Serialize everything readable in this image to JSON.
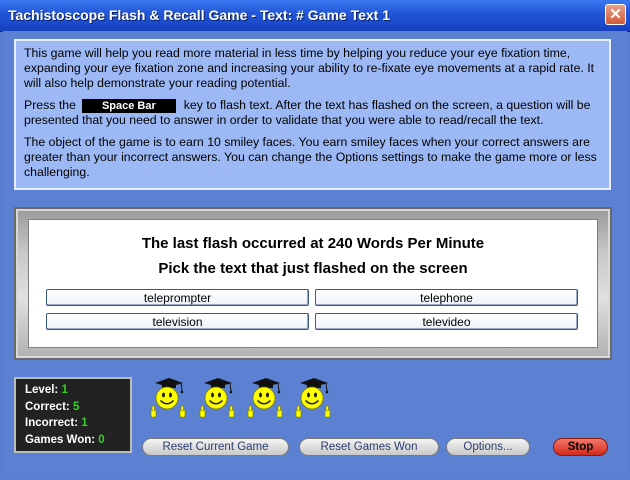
{
  "window": {
    "title": "Tachistoscope Flash & Recall Game - Text: # Game Text 1",
    "close_glyph": "✕"
  },
  "instructions": {
    "p1": "This game will help you read more material in less time by helping you reduce your eye fixation time, expanding your eye fixation zone and increasing your ability to re-fixate eye movements at a rapid rate.  It will also help demonstrate your reading potential.",
    "p2_before": "Press the",
    "key_label": "Space Bar",
    "p2_after": "key to flash text.  After the text has flashed on the screen, a question will be presented that you need to answer in order to validate that you were able to read/recall the text.",
    "p3": "The object of the game is to earn 10 smiley faces.  You earn smiley faces when your correct answers are greater than your incorrect answers.  You can change the Options settings to make the game more or less challenging."
  },
  "flash": {
    "message": "The last flash occurred at 240 Words Per Minute",
    "prompt": "Pick the text that just flashed on the screen",
    "choices": [
      "teleprompter",
      "telephone",
      "television",
      "televideo"
    ]
  },
  "stats": {
    "level_label": "Level:",
    "level_value": "1",
    "correct_label": "Correct:",
    "correct_value": "5",
    "incorrect_label": "Incorrect:",
    "incorrect_value": "1",
    "games_won_label": "Games Won:",
    "games_won_value": "0"
  },
  "smiley_faces": {
    "count": 4,
    "icon": "graduate-smiley-icon"
  },
  "buttons": {
    "reset_game": "Reset Current Game",
    "reset_won": "Reset Games Won",
    "options": "Options...",
    "stop": "Stop"
  },
  "colors": {
    "titlebar": "#2458d8",
    "background": "#5c80d2",
    "panel": "#9db9f5",
    "stats_value": "#34d024",
    "smiley": "#ffff00",
    "stop": "#d22a1a"
  }
}
